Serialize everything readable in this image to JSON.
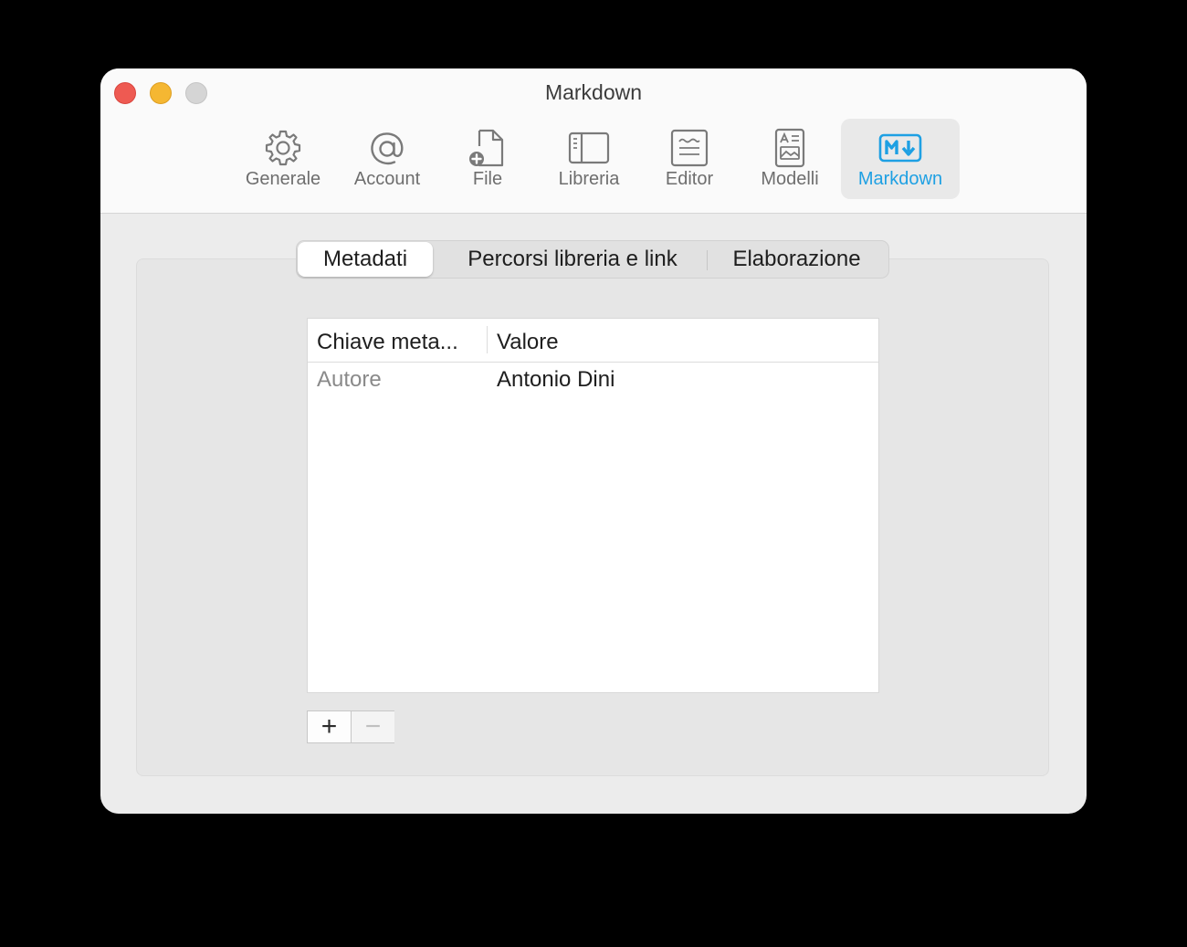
{
  "window": {
    "title": "Markdown"
  },
  "toolbar": {
    "items": [
      {
        "label": "Generale",
        "icon": "gear-icon"
      },
      {
        "label": "Account",
        "icon": "at-sign-icon"
      },
      {
        "label": "File",
        "icon": "file-add-icon"
      },
      {
        "label": "Libreria",
        "icon": "sidebar-icon"
      },
      {
        "label": "Editor",
        "icon": "editor-icon"
      },
      {
        "label": "Modelli",
        "icon": "template-icon"
      },
      {
        "label": "Markdown",
        "icon": "markdown-icon",
        "active": true
      }
    ],
    "accent_color": "#1ea0e3"
  },
  "tabs": {
    "items": [
      {
        "label": "Metadati",
        "selected": true
      },
      {
        "label": "Percorsi libreria e link"
      },
      {
        "label": "Elaborazione"
      }
    ]
  },
  "metadata_table": {
    "columns": [
      "Chiave meta...",
      "Valore"
    ],
    "rows": [
      {
        "key": "Autore",
        "value": "Antonio Dini"
      }
    ]
  },
  "buttons": {
    "add_label": "+",
    "remove_label": "−"
  }
}
